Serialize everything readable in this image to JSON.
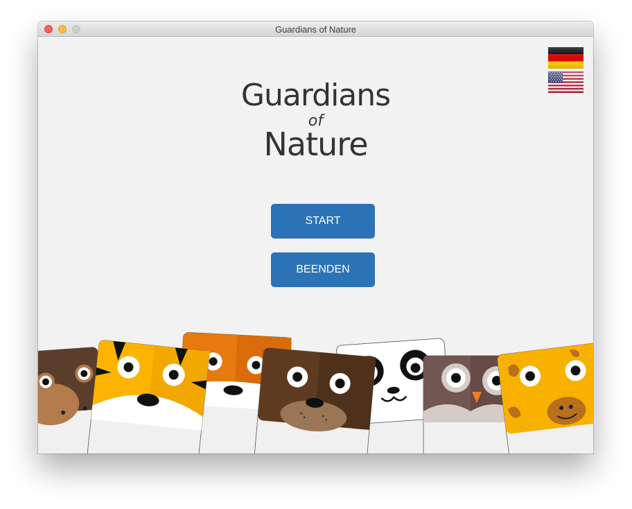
{
  "window": {
    "title": "Guardians of Nature"
  },
  "logo": {
    "line1": "Guardians",
    "line2": "of",
    "line3": "Nature"
  },
  "menu": {
    "start_label": "START",
    "quit_label": "BEENDEN"
  },
  "languages": [
    {
      "name": "german-flag-icon",
      "colors": [
        "#000000",
        "#dd0000",
        "#ffce00"
      ]
    },
    {
      "name": "us-flag-icon",
      "colors": [
        "#b22234",
        "#ffffff",
        "#3c3b6e"
      ]
    }
  ],
  "colors": {
    "button": "#2b72b6",
    "background": "#f2f2f2"
  }
}
